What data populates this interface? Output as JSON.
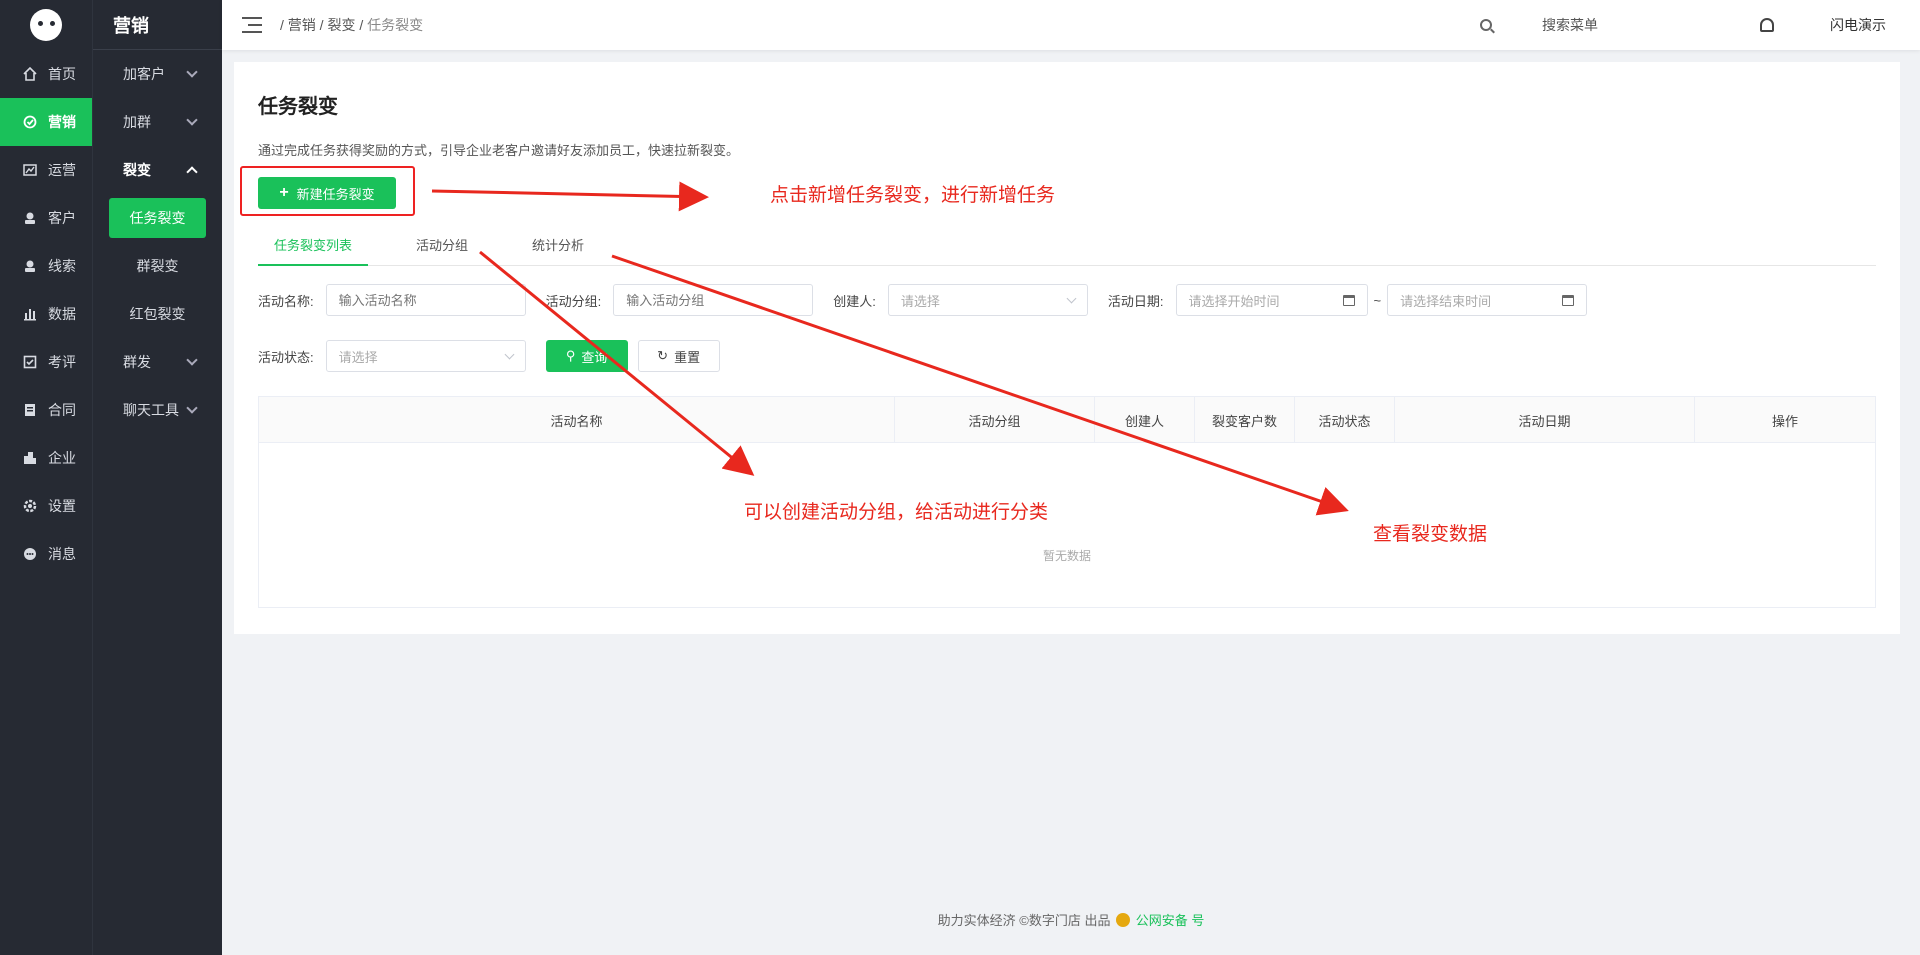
{
  "app": {
    "section_title": "营销"
  },
  "rail": [
    {
      "label": "首页",
      "icon": "home-icon"
    },
    {
      "label": "营销",
      "icon": "marketing-icon",
      "active": true
    },
    {
      "label": "运营",
      "icon": "chart-icon"
    },
    {
      "label": "客户",
      "icon": "customer-icon"
    },
    {
      "label": "线索",
      "icon": "lead-icon"
    },
    {
      "label": "数据",
      "icon": "data-icon"
    },
    {
      "label": "考评",
      "icon": "check-icon"
    },
    {
      "label": "合同",
      "icon": "contract-icon"
    },
    {
      "label": "企业",
      "icon": "company-icon"
    },
    {
      "label": "设置",
      "icon": "gear-icon"
    },
    {
      "label": "消息",
      "icon": "message-icon"
    }
  ],
  "submenu": {
    "add_customer": "加客户",
    "add_group": "加群",
    "fission": "裂变",
    "task_fission": "任务裂变",
    "group_fission": "群裂变",
    "redpacket_fission": "红包裂变",
    "broadcast": "群发",
    "chat_tools": "聊天工具"
  },
  "topbar": {
    "breadcrumb": [
      "营销",
      "裂变",
      "任务裂变"
    ],
    "search_label": "搜索菜单",
    "user": "闪电演示"
  },
  "page": {
    "title": "任务裂变",
    "description": "通过完成任务获得奖励的方式，引导企业老客户邀请好友添加员工，快速拉新裂变。",
    "new_button": "新建任务裂变",
    "tabs": [
      "任务裂变列表",
      "活动分组",
      "统计分析"
    ]
  },
  "filters": {
    "name_label": "活动名称:",
    "name_placeholder": "输入活动名称",
    "group_label": "活动分组:",
    "group_placeholder": "输入活动分组",
    "creator_label": "创建人:",
    "creator_placeholder": "请选择",
    "date_label": "活动日期:",
    "date_start_placeholder": "请选择开始时间",
    "date_sep": "~",
    "date_end_placeholder": "请选择结束时间",
    "status_label": "活动状态:",
    "status_placeholder": "请选择",
    "query_button": "查询",
    "reset_button": "重置"
  },
  "table": {
    "columns": [
      "活动名称",
      "活动分组",
      "创建人",
      "裂变客户数",
      "活动状态",
      "活动日期",
      "操作"
    ],
    "empty_text": "暂无数据"
  },
  "footer": {
    "text": "助力实体经济 ©数字门店 出品",
    "police": "公网安备 号"
  },
  "annotations": {
    "new_task": "点击新增任务裂变，进行新增任务",
    "group": "可以创建活动分组，给活动进行分类",
    "stats": "查看裂变数据"
  },
  "colors": {
    "accent": "#1ac15a",
    "sidebar": "#262a33",
    "annotation": "#e8281e"
  }
}
